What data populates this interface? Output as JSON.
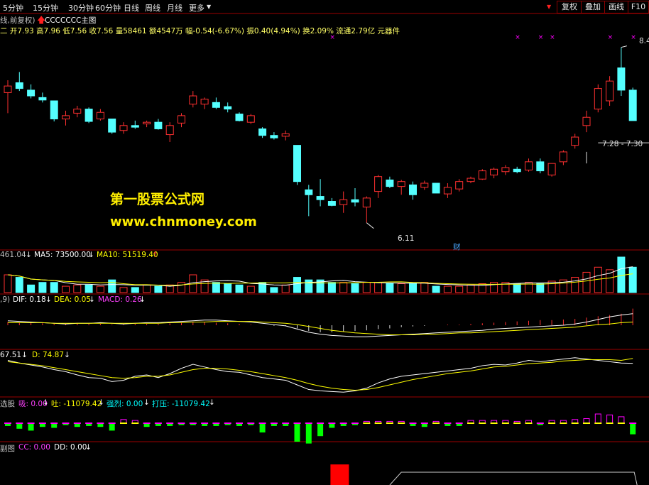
{
  "toolbar": {
    "periods": [
      "5分钟",
      "15分钟",
      "30分钟",
      "60分钟",
      "日线",
      "周线",
      "月线",
      "更多"
    ],
    "arrow": "▼",
    "right_buttons": [
      "复权",
      "叠加",
      "画线",
      "F10"
    ]
  },
  "header": {
    "line1_prefix": "线,前复权)",
    "indicator_name": "CCCCCCC主图",
    "line2": "二 开7.93 高7.96 低7.56 收7.56 量58461 额4547万 幅-0.54(-6.67%) 振0.40(4.94%) 换2.09% 流通2.79亿 元器件"
  },
  "watermark": {
    "line1": "第一股票公式网",
    "line2": "www.chnmoney.com"
  },
  "annotations": {
    "high": "8.4",
    "low": "6.11",
    "range": "7.28 - 7.30",
    "cai": "财"
  },
  "vol_panel": {
    "label_a": "461.04",
    "label_b": "MA5: 73500.00",
    "label_c": "MA10: 51519.40",
    "arrow_down": "↓",
    "arrow_up": "↑"
  },
  "macd_panel": {
    "label_a": ",9)",
    "dif": "DIF: 0.18",
    "dea": "DEA: 0.05",
    "macd": "MACD: 0.26"
  },
  "kd_panel": {
    "k": "67.51",
    "d": "D: 74.87"
  },
  "flow_panel": {
    "name": "选股",
    "xi": "吸: 0.00",
    "tu": "吐: -11079.42",
    "qiang": "强烈: 0.00",
    "daya": "打压: -11079.42"
  },
  "cc_panel": {
    "name": "副图",
    "cc": "CC: 0.00",
    "dd": "DD: 0.00"
  },
  "colors": {
    "up": "#ff3030",
    "down": "#54ffff",
    "panel_border": "#9b0000",
    "white_line": "#ffffff",
    "yellow_line": "#ffff00",
    "magenta": "#ff00ff",
    "green": "#00ff00"
  },
  "chart_data": {
    "type": "candlestick",
    "candles": [
      {
        "o": 7.9,
        "h": 8.05,
        "l": 7.65,
        "c": 7.98
      },
      {
        "o": 8.02,
        "h": 8.15,
        "l": 7.92,
        "c": 7.95
      },
      {
        "o": 7.93,
        "h": 8.0,
        "l": 7.83,
        "c": 7.86
      },
      {
        "o": 7.84,
        "h": 7.9,
        "l": 7.78,
        "c": 7.81
      },
      {
        "o": 7.8,
        "h": 7.8,
        "l": 7.55,
        "c": 7.58
      },
      {
        "o": 7.58,
        "h": 7.68,
        "l": 7.5,
        "c": 7.62
      },
      {
        "o": 7.65,
        "h": 7.74,
        "l": 7.6,
        "c": 7.7
      },
      {
        "o": 7.7,
        "h": 7.72,
        "l": 7.53,
        "c": 7.55
      },
      {
        "o": 7.58,
        "h": 7.7,
        "l": 7.56,
        "c": 7.66
      },
      {
        "o": 7.58,
        "h": 7.58,
        "l": 7.4,
        "c": 7.42
      },
      {
        "o": 7.44,
        "h": 7.54,
        "l": 7.4,
        "c": 7.5
      },
      {
        "o": 7.5,
        "h": 7.56,
        "l": 7.46,
        "c": 7.48
      },
      {
        "o": 7.52,
        "h": 7.56,
        "l": 7.48,
        "c": 7.54
      },
      {
        "o": 7.54,
        "h": 7.58,
        "l": 7.45,
        "c": 7.46
      },
      {
        "o": 7.39,
        "h": 7.54,
        "l": 7.3,
        "c": 7.5
      },
      {
        "o": 7.53,
        "h": 7.65,
        "l": 7.48,
        "c": 7.62
      },
      {
        "o": 7.76,
        "h": 7.92,
        "l": 7.72,
        "c": 7.86
      },
      {
        "o": 7.76,
        "h": 7.84,
        "l": 7.7,
        "c": 7.82
      },
      {
        "o": 7.78,
        "h": 7.84,
        "l": 7.7,
        "c": 7.72
      },
      {
        "o": 7.73,
        "h": 7.78,
        "l": 7.66,
        "c": 7.7
      },
      {
        "o": 7.64,
        "h": 7.66,
        "l": 7.55,
        "c": 7.56
      },
      {
        "o": 7.54,
        "h": 7.64,
        "l": 7.52,
        "c": 7.62
      },
      {
        "o": 7.46,
        "h": 7.48,
        "l": 7.35,
        "c": 7.38
      },
      {
        "o": 7.38,
        "h": 7.42,
        "l": 7.33,
        "c": 7.35
      },
      {
        "o": 7.37,
        "h": 7.44,
        "l": 7.32,
        "c": 7.4
      },
      {
        "o": 7.26,
        "h": 7.26,
        "l": 6.78,
        "c": 6.82
      },
      {
        "o": 6.72,
        "h": 6.78,
        "l": 6.4,
        "c": 6.66
      },
      {
        "o": 6.64,
        "h": 6.85,
        "l": 6.52,
        "c": 6.6
      },
      {
        "o": 6.58,
        "h": 6.62,
        "l": 6.52,
        "c": 6.53
      },
      {
        "o": 6.54,
        "h": 6.7,
        "l": 6.44,
        "c": 6.6
      },
      {
        "o": 6.6,
        "h": 6.74,
        "l": 6.52,
        "c": 6.57
      },
      {
        "o": 6.51,
        "h": 6.64,
        "l": 6.32,
        "c": 6.62
      },
      {
        "o": 6.7,
        "h": 6.9,
        "l": 6.62,
        "c": 6.88
      },
      {
        "o": 6.84,
        "h": 6.88,
        "l": 6.74,
        "c": 6.76
      },
      {
        "o": 6.76,
        "h": 6.84,
        "l": 6.66,
        "c": 6.82
      },
      {
        "o": 6.78,
        "h": 6.82,
        "l": 6.6,
        "c": 6.66
      },
      {
        "o": 6.75,
        "h": 6.83,
        "l": 6.72,
        "c": 6.8
      },
      {
        "o": 6.8,
        "h": 6.8,
        "l": 6.7,
        "c": 6.68
      },
      {
        "o": 6.67,
        "h": 6.8,
        "l": 6.62,
        "c": 6.75
      },
      {
        "o": 6.73,
        "h": 6.85,
        "l": 6.7,
        "c": 6.82
      },
      {
        "o": 6.82,
        "h": 6.88,
        "l": 6.8,
        "c": 6.86
      },
      {
        "o": 6.85,
        "h": 6.97,
        "l": 6.84,
        "c": 6.95
      },
      {
        "o": 6.9,
        "h": 6.99,
        "l": 6.86,
        "c": 6.97
      },
      {
        "o": 6.94,
        "h": 7.02,
        "l": 6.9,
        "c": 6.99
      },
      {
        "o": 6.97,
        "h": 7.0,
        "l": 6.92,
        "c": 6.94
      },
      {
        "o": 6.96,
        "h": 7.1,
        "l": 6.94,
        "c": 7.06
      },
      {
        "o": 7.06,
        "h": 7.1,
        "l": 6.92,
        "c": 6.95
      },
      {
        "o": 6.9,
        "h": 7.04,
        "l": 6.88,
        "c": 7.04
      },
      {
        "o": 7.06,
        "h": 7.2,
        "l": 7.02,
        "c": 7.18
      },
      {
        "o": 7.26,
        "h": 7.4,
        "l": 7.22,
        "c": 7.36
      },
      {
        "o": 7.5,
        "h": 7.68,
        "l": 7.42,
        "c": 7.6
      },
      {
        "o": 7.7,
        "h": 8.0,
        "l": 7.66,
        "c": 7.95
      },
      {
        "o": 7.8,
        "h": 8.1,
        "l": 7.74,
        "c": 8.04
      },
      {
        "o": 8.2,
        "h": 8.45,
        "l": 7.86,
        "c": 7.93
      },
      {
        "o": 7.93,
        "h": 7.96,
        "l": 7.56,
        "c": 7.56
      }
    ],
    "ylim": [
      6.05,
      8.55
    ],
    "volume": [
      14,
      12,
      6,
      8,
      8,
      5,
      6,
      6,
      5,
      10,
      4,
      4,
      6,
      5,
      6,
      8,
      14,
      10,
      8,
      7,
      6,
      5,
      8,
      4,
      6,
      12,
      10,
      10,
      8,
      8,
      7,
      8,
      8,
      7,
      7,
      7,
      8,
      5,
      5,
      5,
      6,
      7,
      8,
      8,
      7,
      8,
      7,
      9,
      10,
      12,
      16,
      20,
      18,
      28,
      20
    ],
    "macd_hist": [
      0.05,
      0.04,
      0.04,
      0.03,
      0.02,
      0.02,
      0.03,
      0.02,
      0.02,
      0.01,
      0.01,
      0.02,
      0.02,
      0.02,
      0.03,
      0.04,
      0.05,
      0.05,
      0.04,
      0.03,
      0.02,
      0.01,
      0.0,
      -0.01,
      -0.01,
      -0.05,
      -0.09,
      -0.11,
      -0.11,
      -0.1,
      -0.09,
      -0.08,
      -0.06,
      -0.05,
      -0.03,
      -0.02,
      -0.01,
      0.0,
      0.01,
      0.01,
      0.02,
      0.03,
      0.04,
      0.05,
      0.06,
      0.07,
      0.08,
      0.08,
      0.09,
      0.1,
      0.12,
      0.14,
      0.16,
      0.18,
      0.26
    ],
    "dif": [
      0.07,
      0.06,
      0.05,
      0.04,
      0.03,
      0.02,
      0.03,
      0.03,
      0.04,
      0.03,
      0.02,
      0.03,
      0.04,
      0.04,
      0.05,
      0.06,
      0.07,
      0.08,
      0.08,
      0.07,
      0.06,
      0.05,
      0.03,
      0.01,
      -0.01,
      -0.06,
      -0.11,
      -0.14,
      -0.16,
      -0.17,
      -0.18,
      -0.18,
      -0.17,
      -0.16,
      -0.15,
      -0.14,
      -0.13,
      -0.12,
      -0.11,
      -0.1,
      -0.09,
      -0.08,
      -0.06,
      -0.05,
      -0.04,
      -0.03,
      -0.02,
      -0.01,
      0.0,
      0.02,
      0.05,
      0.09,
      0.13,
      0.16,
      0.18
    ],
    "dea": [
      0.04,
      0.04,
      0.04,
      0.04,
      0.03,
      0.03,
      0.03,
      0.03,
      0.03,
      0.03,
      0.03,
      0.03,
      0.03,
      0.03,
      0.04,
      0.04,
      0.05,
      0.05,
      0.06,
      0.06,
      0.06,
      0.06,
      0.05,
      0.04,
      0.03,
      0.01,
      -0.02,
      -0.05,
      -0.08,
      -0.1,
      -0.12,
      -0.13,
      -0.14,
      -0.15,
      -0.15,
      -0.15,
      -0.14,
      -0.14,
      -0.13,
      -0.12,
      -0.12,
      -0.11,
      -0.1,
      -0.09,
      -0.08,
      -0.07,
      -0.06,
      -0.05,
      -0.04,
      -0.03,
      -0.01,
      0.01,
      0.02,
      0.04,
      0.05
    ],
    "k": [
      72,
      68,
      65,
      62,
      58,
      55,
      50,
      46,
      45,
      40,
      42,
      48,
      50,
      46,
      52,
      60,
      66,
      62,
      58,
      55,
      54,
      50,
      46,
      44,
      42,
      35,
      28,
      26,
      25,
      24,
      26,
      30,
      38,
      44,
      48,
      50,
      52,
      54,
      56,
      58,
      60,
      64,
      66,
      65,
      68,
      72,
      70,
      72,
      74,
      76,
      74,
      72,
      70,
      68,
      67.51
    ],
    "d": [
      70,
      68,
      66,
      64,
      61,
      58,
      55,
      52,
      49,
      46,
      45,
      46,
      48,
      48,
      50,
      54,
      58,
      60,
      60,
      59,
      57,
      55,
      52,
      49,
      46,
      42,
      37,
      33,
      30,
      28,
      27,
      28,
      31,
      35,
      39,
      43,
      46,
      49,
      52,
      54,
      56,
      59,
      62,
      63,
      65,
      67,
      68,
      69,
      71,
      72,
      73,
      73,
      73,
      72,
      74.87
    ],
    "flow": [
      -3,
      -6,
      -8,
      -4,
      -5,
      -2,
      -4,
      -3,
      -4,
      -8,
      4,
      3,
      -4,
      -3,
      -3,
      -2,
      -2,
      -3,
      -3,
      -2,
      -3,
      -2,
      -10,
      -3,
      -3,
      -20,
      -22,
      -14,
      -5,
      -3,
      -2,
      2,
      2,
      2,
      2,
      -3,
      -4,
      2,
      -3,
      -3,
      3,
      3,
      3,
      3,
      2,
      3,
      -2,
      3,
      3,
      4,
      5,
      10,
      9,
      7,
      -12
    ],
    "cc": [
      0,
      0,
      0,
      0,
      0,
      0,
      0,
      0,
      0,
      0,
      0,
      0,
      0,
      0,
      0,
      0,
      0,
      0,
      0,
      0,
      0,
      0,
      0,
      0,
      0,
      0,
      0,
      0,
      1,
      0,
      0,
      0,
      0,
      0,
      0,
      0,
      0,
      0,
      0,
      0,
      0,
      0,
      0,
      0,
      0,
      0,
      0,
      0,
      0,
      0,
      0,
      0,
      0,
      0,
      0
    ]
  }
}
